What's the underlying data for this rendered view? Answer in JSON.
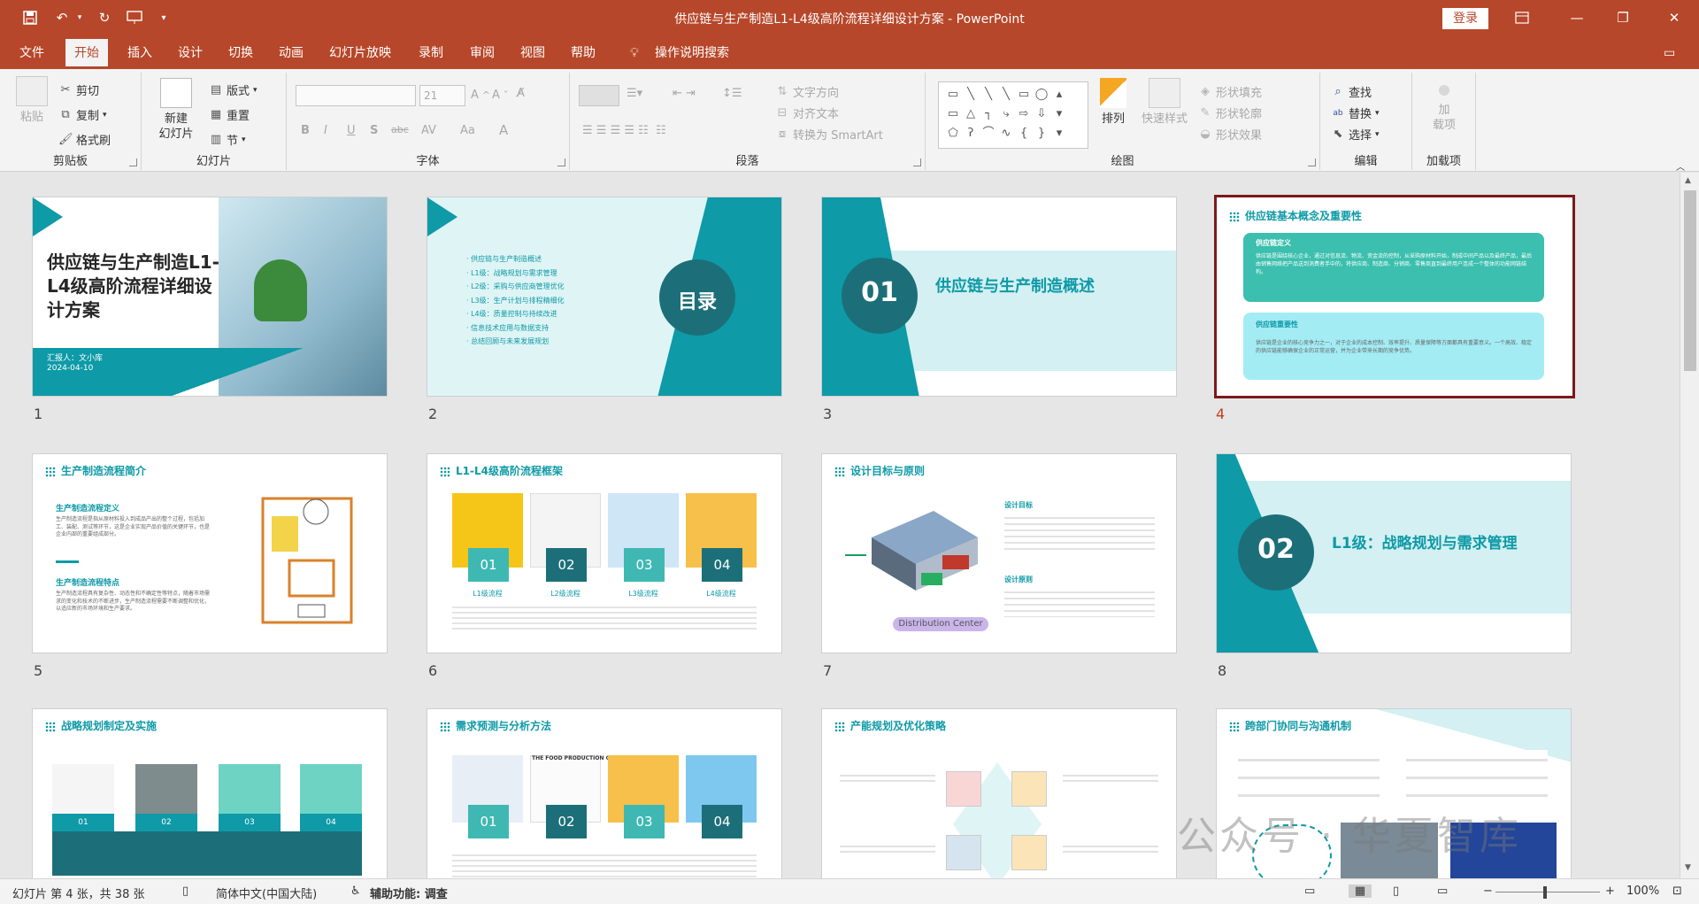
{
  "app": {
    "window_title": "供应链与生产制造L1-L4级高阶流程详细设计方案  -  PowerPoint",
    "login_label": "登录"
  },
  "menu": {
    "tabs": [
      "文件",
      "开始",
      "插入",
      "设计",
      "切换",
      "动画",
      "幻灯片放映",
      "录制",
      "审阅",
      "视图",
      "帮助"
    ],
    "active_tab": "开始",
    "search_label": "操作说明搜索"
  },
  "ribbon": {
    "clipboard": {
      "label": "剪贴板",
      "paste": "粘贴",
      "cut": "剪切",
      "copy": "复制",
      "format_painter": "格式刷"
    },
    "slides": {
      "label": "幻灯片",
      "new_slide_line1": "新建",
      "new_slide_line2": "幻灯片",
      "layout": "版式",
      "reset": "重置",
      "section": "节"
    },
    "font": {
      "label": "字体",
      "font_size": "21",
      "bold": "B",
      "italic": "I",
      "underline": "U",
      "shadow": "S",
      "strike": "abc",
      "spacing": "AV",
      "case": "Aa",
      "color": "A"
    },
    "paragraph": {
      "label": "段落",
      "text_direction": "文字方向",
      "align_text": "对齐文本",
      "smartart": "转换为 SmartArt"
    },
    "drawing": {
      "label": "绘图",
      "arrange": "排列",
      "quick_styles": "快速样式",
      "shape_fill": "形状填充",
      "shape_outline": "形状轮廓",
      "shape_effects": "形状效果"
    },
    "editing": {
      "label": "编辑",
      "find": "查找",
      "replace": "替换",
      "select": "选择"
    },
    "addins": {
      "label": "加载项",
      "addin_line1": "加",
      "addin_line2": "载项"
    }
  },
  "slides": [
    {
      "num": "1",
      "title": "供应链与生产制造L1-L4级高阶流程详细设计方案",
      "reporter": "汇报人：文小库",
      "date": "2024-04-10"
    },
    {
      "num": "2",
      "title": "目录",
      "items": [
        "供应链与生产制造概述",
        "L1级：战略规划与需求管理",
        "L2级：采购与供应商管理优化",
        "L3级：生产计划与排程精细化",
        "L4级：质量控制与持续改进",
        "信息技术应用与数据支持",
        "总结回顾与未来发展规划"
      ]
    },
    {
      "num": "3",
      "badge": "01",
      "title": "供应链与生产制造概述"
    },
    {
      "num": "4",
      "title": "供应链基本概念及重要性",
      "box1_title": "供应链定义",
      "box1_text": "供应链是围绕核心企业，通过对信息流、物流、资金流的控制，从采购原材料开始，制成中间产品以及最终产品，最后由销售网络把产品送到消费者手中的，将供应商、制造商、分销商、零售商直到最终用户连成一个整体的功能网链结构。",
      "box2_title": "供应链重要性",
      "box2_text": "供应链是企业的核心竞争力之一，对于企业的成本控制、效率提升、质量保障等方面都具有重要意义。一个高效、稳定的供应链能够确保企业的正常运营，并为企业带来长期的竞争优势。"
    },
    {
      "num": "5",
      "title": "生产制造流程简介",
      "sub1": "生产制造流程定义",
      "text1": "生产制造流程是指从原材料投入到成品产出的整个过程，包括加工、装配、测试等环节，这是企业实现产品价值的关键环节，也是企业内部的重要组成部分。",
      "sub2": "生产制造流程特点",
      "text2": "生产制造流程具有复杂性、动态性和不确定性等特点，随着市场需求的变化和技术的不断进步，生产制造流程需要不断调整和优化，以适应新的市场环境和生产要求。"
    },
    {
      "num": "6",
      "title": "L1-L4级高阶流程框架",
      "cards": [
        {
          "badge": "01",
          "label": "L1级流程"
        },
        {
          "badge": "02",
          "label": "L2级流程"
        },
        {
          "badge": "03",
          "label": "L3级流程"
        },
        {
          "badge": "04",
          "label": "L4级流程"
        }
      ]
    },
    {
      "num": "7",
      "title": "设计目标与原则",
      "sub1": "设计目标",
      "sub2": "设计原则",
      "image_caption": "Distribution Center"
    },
    {
      "num": "8",
      "badge": "02",
      "title": "L1级：战略规划与需求管理"
    },
    {
      "num": "9",
      "title": "战略规划制定及实施",
      "badges": [
        "01",
        "02",
        "03",
        "04"
      ]
    },
    {
      "num": "10",
      "title": "需求预测与分析方法",
      "badges": [
        "01",
        "02",
        "03",
        "04"
      ],
      "image_caption": "THE FOOD PRODUCTION CHAIN"
    },
    {
      "num": "11",
      "title": "产能规划及优化策略"
    },
    {
      "num": "12",
      "title": "跨部门协同与沟通机制"
    }
  ],
  "status": {
    "slide_info": "幻灯片 第 4 张，共 38 张",
    "language": "简体中文(中国大陆)",
    "accessibility": "辅助功能: 调查",
    "zoom": "100%"
  },
  "watermark": {
    "text": "公众号 · 华夏智库"
  },
  "colors": {
    "accent": "#b7472a",
    "teal": "#0e9aa7",
    "selected_border": "#7b1a1a"
  }
}
